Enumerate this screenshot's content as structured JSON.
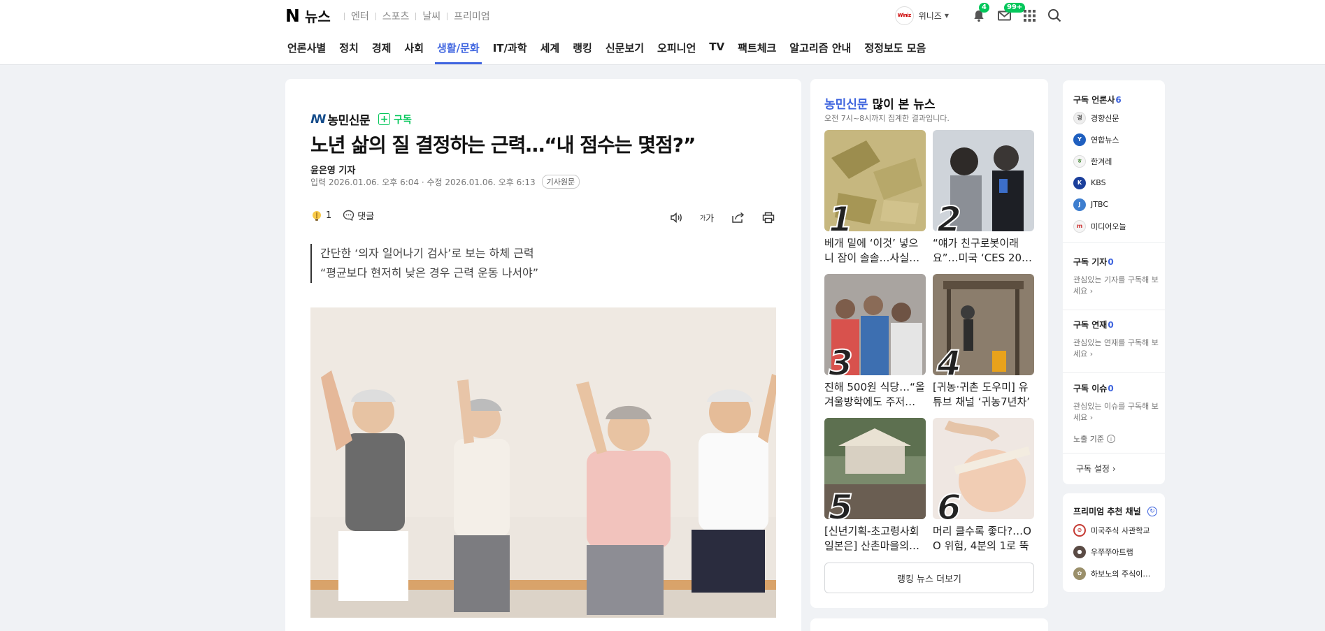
{
  "header": {
    "logo_n": "N",
    "logo_news": "뉴스",
    "service_links": [
      "엔터",
      "스포츠",
      "날씨",
      "프리미엄"
    ],
    "user_avatar_text": "Winiz",
    "user_name": "위니즈",
    "notification_count": "4",
    "mail_count": "99+"
  },
  "nav": {
    "items": [
      "언론사별",
      "정치",
      "경제",
      "사회",
      "생활/문화",
      "IT/과학",
      "세계",
      "랭킹",
      "신문보기",
      "오피니언",
      "TV",
      "팩트체크",
      "알고리즘 안내",
      "정정보도 모음"
    ],
    "active_index": 4
  },
  "article": {
    "press_name": "농민신문",
    "subscribe_label": "구독",
    "headline": "노년 삶의 질 결정하는 근력…“내 점수는 몇점?”",
    "reporter": "윤은영 기자",
    "dates": "입력 2026.01.06. 오후 6:04 · 수정 2026.01.06. 오후 6:13",
    "original_label": "기사원문",
    "reaction_count": "1",
    "comment_label": "댓글",
    "font_size_label": "가",
    "summary_line1": "간단한 ‘의자 일어나기 검사’로 보는 하체 근력",
    "summary_line2": "“평균보다 현저히 낮은 경우 근력 운동 나서야”"
  },
  "ranking": {
    "press": "농민신문",
    "title_rest": " 많이 본 뉴스",
    "subtitle": "오전 7시~8시까지 집계한 결과입니다.",
    "items": [
      {
        "num": "1",
        "text": "베개 밑에 ‘이것’ 넣으니 잠이 솔솔…사실…"
      },
      {
        "num": "2",
        "text": "“얘가 친구로봇이래요”…미국 ‘CES 20…"
      },
      {
        "num": "3",
        "text": "진해 500원 식당…“올 겨울방학에도 주저…"
      },
      {
        "num": "4",
        "text": "[귀농·귀촌 도우미] 유튜브 채널 ‘귀농7년차’"
      },
      {
        "num": "5",
        "text": "[신년기획-초고령사회 일본은] 산촌마을의…"
      },
      {
        "num": "6",
        "text": "머리 클수록 좋다?…OO 위험, 4분의 1로 뚝"
      }
    ],
    "more_label": "랭킹 뉴스 더보기"
  },
  "sidebar": {
    "subscribed_press_label": "구독 언론사",
    "subscribed_press_count": "6",
    "press_list": [
      {
        "name": "경향신문",
        "color": "#e9e9e9"
      },
      {
        "name": "연합뉴스",
        "color": "#1f5fbf"
      },
      {
        "name": "한겨레",
        "color": "#f2f2f2"
      },
      {
        "name": "KBS",
        "color": "#1b3f9b"
      },
      {
        "name": "JTBC",
        "color": "#3e7ecf"
      },
      {
        "name": "미디어오늘",
        "color": "#f5f5f5"
      }
    ],
    "reporter_label": "구독 기자",
    "reporter_count": "0",
    "reporter_desc": "관심있는 기자를 구독해 보세요",
    "series_label": "구독 연재",
    "series_count": "0",
    "series_desc": "관심있는 연재를 구독해 보세요",
    "issue_label": "구독 이슈",
    "issue_count": "0",
    "issue_desc": "관심있는 이슈를 구독해 보세요",
    "exposure_label": "노출 기준",
    "settings_label": "구독 설정",
    "premium_title": "프리미엄 추천 채널",
    "premium_channels": [
      "미국주식 사관학교",
      "우쭈쭈아트랩",
      "하보노의 주식이…"
    ]
  },
  "colors": {
    "accent": "#4066e0",
    "green": "#03c75a"
  }
}
